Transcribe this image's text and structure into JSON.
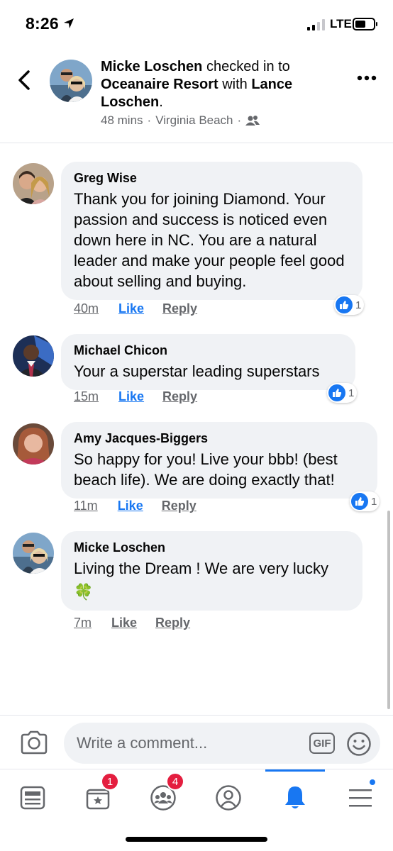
{
  "status_bar": {
    "time": "8:26",
    "network": "LTE"
  },
  "post_header": {
    "author": "Micke Loschen",
    "checked_in_text": " checked in to ",
    "place": "Oceanaire Resort",
    "with_text": " with ",
    "tagged": "Lance Loschen",
    "period": ".",
    "time_ago": "48 mins",
    "separator": "·",
    "location": "Virginia Beach"
  },
  "comments": [
    {
      "name": "Greg Wise",
      "text": "Thank you for joining Diamond. Your passion and success is noticed even down here in NC. You are a natural leader and make your people feel good about selling and buying.",
      "time": "40m",
      "like_label": "Like",
      "reply_label": "Reply",
      "reactions": "1"
    },
    {
      "name": "Michael Chicon",
      "text": "Your a superstar leading superstars",
      "time": "15m",
      "like_label": "Like",
      "reply_label": "Reply",
      "reactions": "1"
    },
    {
      "name": "Amy Jacques-Biggers",
      "text": "So happy for you! Live your bbb! (best beach life).  We are doing exactly that!",
      "time": "11m",
      "like_label": "Like",
      "reply_label": "Reply",
      "reactions": "1"
    },
    {
      "name": "Micke Loschen",
      "text": "Living the Dream ! We are very lucky",
      "emoji": "🍀",
      "time": "7m",
      "like_label": "Like",
      "reply_label": "Reply"
    }
  ],
  "composer": {
    "placeholder": "Write a comment...",
    "gif_label": "GIF"
  },
  "tabbar": {
    "tabs": [
      {
        "name": "news-feed",
        "badge": ""
      },
      {
        "name": "pages",
        "badge": "1"
      },
      {
        "name": "groups",
        "badge": "4"
      },
      {
        "name": "profile",
        "badge": ""
      },
      {
        "name": "notifications",
        "badge": "",
        "active": true
      },
      {
        "name": "menu",
        "badge": ""
      }
    ]
  },
  "colors": {
    "accent": "#1877f2",
    "badge": "#e41e3f",
    "bubble": "#f0f2f5",
    "secondary_text": "#65676b"
  }
}
